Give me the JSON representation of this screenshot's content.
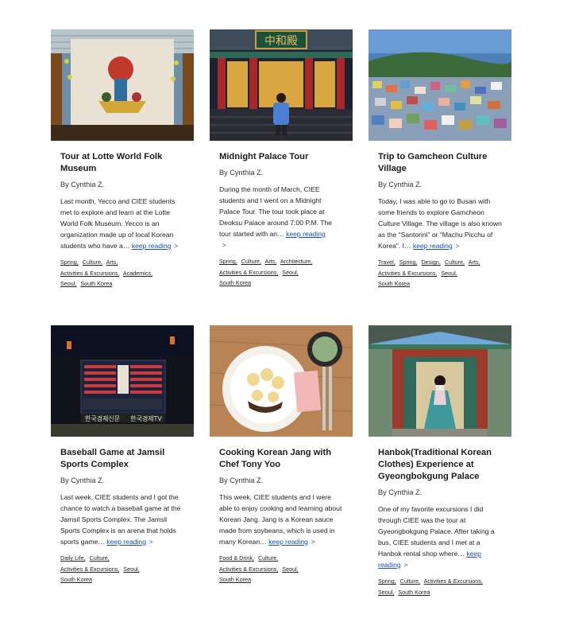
{
  "posts": [
    {
      "title": "Tour at Lotte World Folk Museum",
      "author": "By Cynthia Z.",
      "excerpt": "Last month, Yecco and CIEE students met to explore and learn at the Lotte World Folk Museum. Yecco is an organization made up of local Korean students who have a…",
      "more": "keep reading",
      "arrow": ">",
      "tags": [
        "Spring,",
        "Culture,",
        "Arts,",
        "Activities & Excursions,",
        "Academics,",
        "Seoul,",
        "South Korea"
      ]
    },
    {
      "title": "Midnight Palace Tour",
      "author": "By Cynthia Z.",
      "excerpt": "During the month of March, CIEE students and I went on a Midnight Palace Tour. The tour took place at Deoksu Palace around 7:00 P.M. The tour started with an…",
      "more": "keep reading",
      "arrow": ">",
      "tags": [
        "Spring,",
        "Culture,",
        "Arts,",
        "Architecture,",
        "Activities & Excursions,",
        "Seoul,",
        "South Korea"
      ]
    },
    {
      "title": "Trip to Gamcheon Culture Village",
      "author": "By Cynthia Z.",
      "excerpt": "Today, I was able to go to Busan with some friends to explore Gamcheon Culture Village. The village is also known as the “Santorini” or “Machu Picchu of Korea”. I…",
      "more": "keep reading",
      "arrow": ">",
      "tags": [
        "Travel,",
        "Spring,",
        "Design,",
        "Culture,",
        "Arts,",
        "Activities & Excursions,",
        "Seoul,",
        "South Korea"
      ]
    },
    {
      "title": "Baseball Game at Jamsil Sports Complex",
      "author": "By Cynthia Z.",
      "excerpt": "Last week, CIEE students and I got the chance to watch a baseball game at the Jamsil Sports Complex. The Jamsil Sports Complex is an arena that holds sports game…",
      "more": "keep reading",
      "arrow": ">",
      "tags": [
        "Daily Life,",
        "Culture,",
        "Activities & Excursions,",
        "Seoul,",
        "South Korea"
      ]
    },
    {
      "title": "Cooking Korean Jang with Chef Tony Yoo",
      "author": "By Cynthia Z.",
      "excerpt": "This week, CIEE students and I were able to enjoy cooking and learning about Korean Jang. Jang is a Korean sauce made from soybeans, which is used in many Korean…",
      "more": "keep reading",
      "arrow": ">",
      "tags": [
        "Food & Drink,",
        "Culture,",
        "Activities & Excursions,",
        "Seoul,",
        "South Korea"
      ]
    },
    {
      "title": "Hanbok(Traditional Korean Clothes) Experience at Gyeongbokgung Palace",
      "author": "By Cynthia Z.",
      "excerpt": "One of my favorite excursions I did through CIEE was the tour at Gyeongbokgung Palace. After taking a bus, CIEE students and I met at a Hanbok rental shop where…",
      "more": "keep reading",
      "arrow": ">",
      "tags": [
        "Spring,",
        "Culture,",
        "Activities & Excursions,",
        "Seoul,",
        "South Korea"
      ]
    }
  ],
  "images": {
    "palace_sign": "中和殿",
    "stadium_sign1": "한국경제신문",
    "stadium_sign2": "한국경제TV"
  }
}
